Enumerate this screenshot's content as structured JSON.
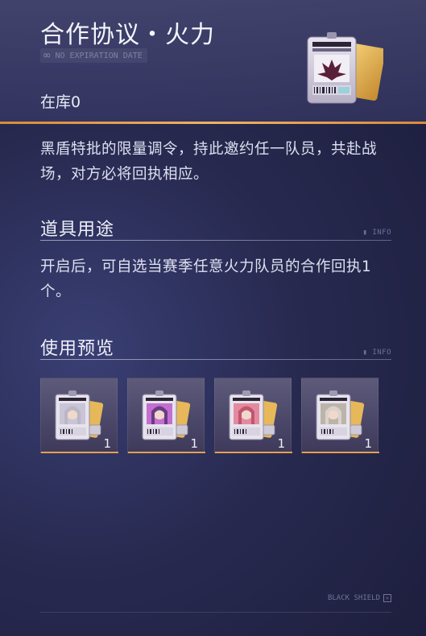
{
  "header": {
    "title": "合作协议・火力",
    "expiry_label": "NO EXPIRATION DATE",
    "expiry_icon": "infinity-icon",
    "stock_label": "在库0"
  },
  "description": "黑盾特批的限量调令，持此邀约任一队员，共赴战场，对方必将回执相应。",
  "sections": {
    "usage": {
      "title": "道具用途",
      "info_tag": "INFO",
      "text": "开启后，可自选当赛季任意火力队员的合作回执1个。"
    },
    "preview": {
      "title": "使用预览",
      "info_tag": "INFO",
      "items": [
        {
          "qty": "1",
          "hair": "#b9b8c4",
          "accent": "#c9c4d8"
        },
        {
          "qty": "1",
          "hair": "#6a3b86",
          "accent": "#c26fd0"
        },
        {
          "qty": "1",
          "hair": "#c0566e",
          "accent": "#e48aa0"
        },
        {
          "qty": "1",
          "hair": "#d8d3cc",
          "accent": "#bcb4aa"
        }
      ]
    }
  },
  "footer": {
    "brand": "BLACK SHIELD"
  },
  "colors": {
    "accent_orange": "#e3a052",
    "background": "#27294f"
  }
}
